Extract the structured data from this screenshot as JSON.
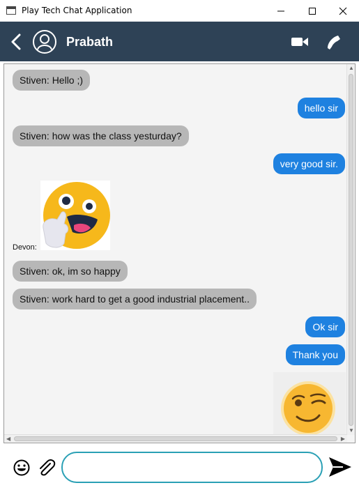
{
  "window": {
    "title": "Play Tech Chat Application"
  },
  "header": {
    "contact_name": "Prabath"
  },
  "messages": [
    {
      "side": "in",
      "sender": "Stiven",
      "text": "Stiven:  Hello ;)"
    },
    {
      "side": "out",
      "text": "hello sir"
    },
    {
      "side": "in",
      "sender": "Stiven",
      "text": "Stiven:  how was the class yesturday?"
    },
    {
      "side": "out",
      "text": "very good sir."
    },
    {
      "side": "in",
      "sender": "Devon",
      "type": "sticker",
      "sticker": "thumbs-up-emoji",
      "label": "Devon:"
    },
    {
      "side": "in",
      "sender": "Stiven",
      "text": "Stiven:  ok, im so happy"
    },
    {
      "side": "in",
      "sender": "Stiven",
      "text": "Stiven:  work hard to get a good industrial placement.."
    },
    {
      "side": "out",
      "text": "Ok sir"
    },
    {
      "side": "out",
      "text": "Thank you"
    },
    {
      "side": "out",
      "type": "sticker",
      "sticker": "winking-face-emoji"
    }
  ],
  "composer": {
    "value": "",
    "placeholder": ""
  },
  "colors": {
    "header_bg": "#2e4256",
    "incoming_bubble": "#b7b7b7",
    "outgoing_bubble": "#1e81e0",
    "input_border": "#2aa0b5"
  },
  "icons": [
    "back-arrow-icon",
    "user-avatar-icon",
    "video-call-icon",
    "phone-call-icon",
    "emoji-icon",
    "attach-icon",
    "send-icon"
  ]
}
